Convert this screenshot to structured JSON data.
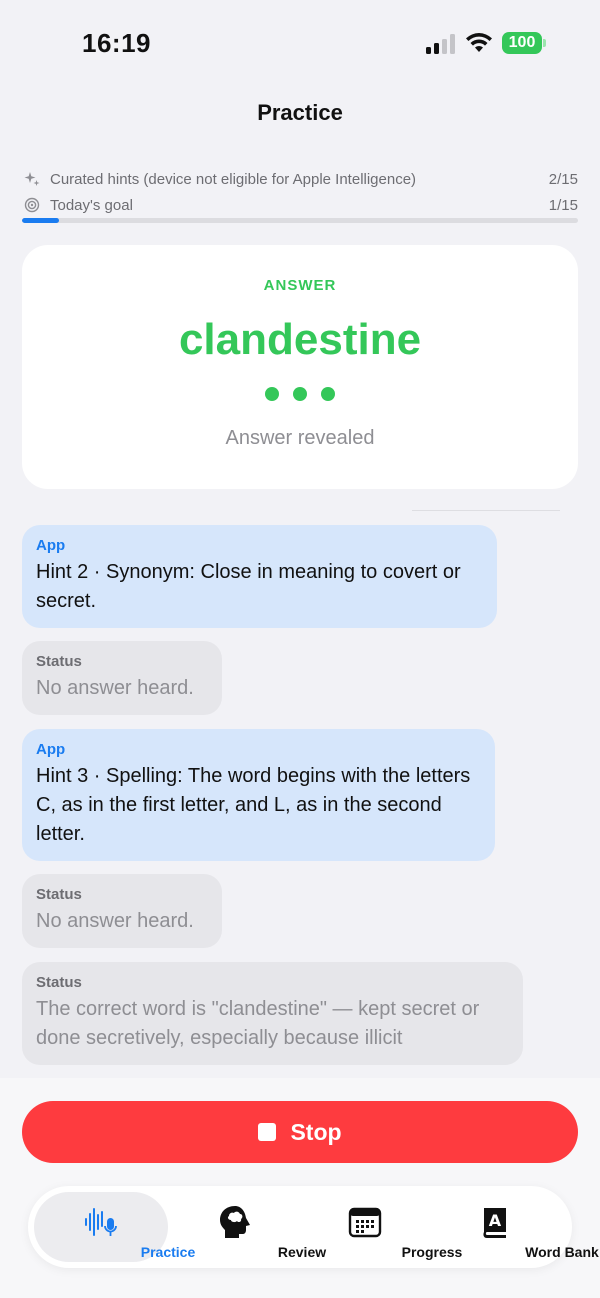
{
  "status_bar": {
    "time": "16:19",
    "battery": "100"
  },
  "nav": {
    "title": "Practice"
  },
  "progress": {
    "hints_text": "Curated hints (device not eligible for Apple Intelligence)",
    "hints_count": "2/15",
    "goal_text": "Today's goal",
    "goal_count": "1/15",
    "goal_fraction": 0.067
  },
  "answer_card": {
    "label": "ANSWER",
    "word": "clandestine",
    "status": "Answer revealed"
  },
  "messages": [
    {
      "sender": "App",
      "text": "Hint 2 · Synonym: Close in meaning to covert or secret."
    },
    {
      "sender": "Status",
      "text": "No answer heard."
    },
    {
      "sender": "App",
      "text": "Hint 3 · Spelling: The word begins with the letters C, as in the first letter, and L, as in the second letter."
    },
    {
      "sender": "Status",
      "text": "No answer heard."
    },
    {
      "sender": "Status",
      "text": "The correct word is \"clandestine\" — kept secret or done secretively, especially because illicit"
    }
  ],
  "stop_button": {
    "label": "Stop"
  },
  "tabs": [
    {
      "label": "Practice",
      "icon": "waveform-mic-icon",
      "active": true
    },
    {
      "label": "Review",
      "icon": "brain-head-icon",
      "active": false
    },
    {
      "label": "Progress",
      "icon": "calendar-icon",
      "active": false
    },
    {
      "label": "Word Bank",
      "icon": "dictionary-book-icon",
      "active": false
    }
  ],
  "colors": {
    "accent": "#1a7cf0",
    "success": "#34c759",
    "stop": "#fe3b3f"
  }
}
